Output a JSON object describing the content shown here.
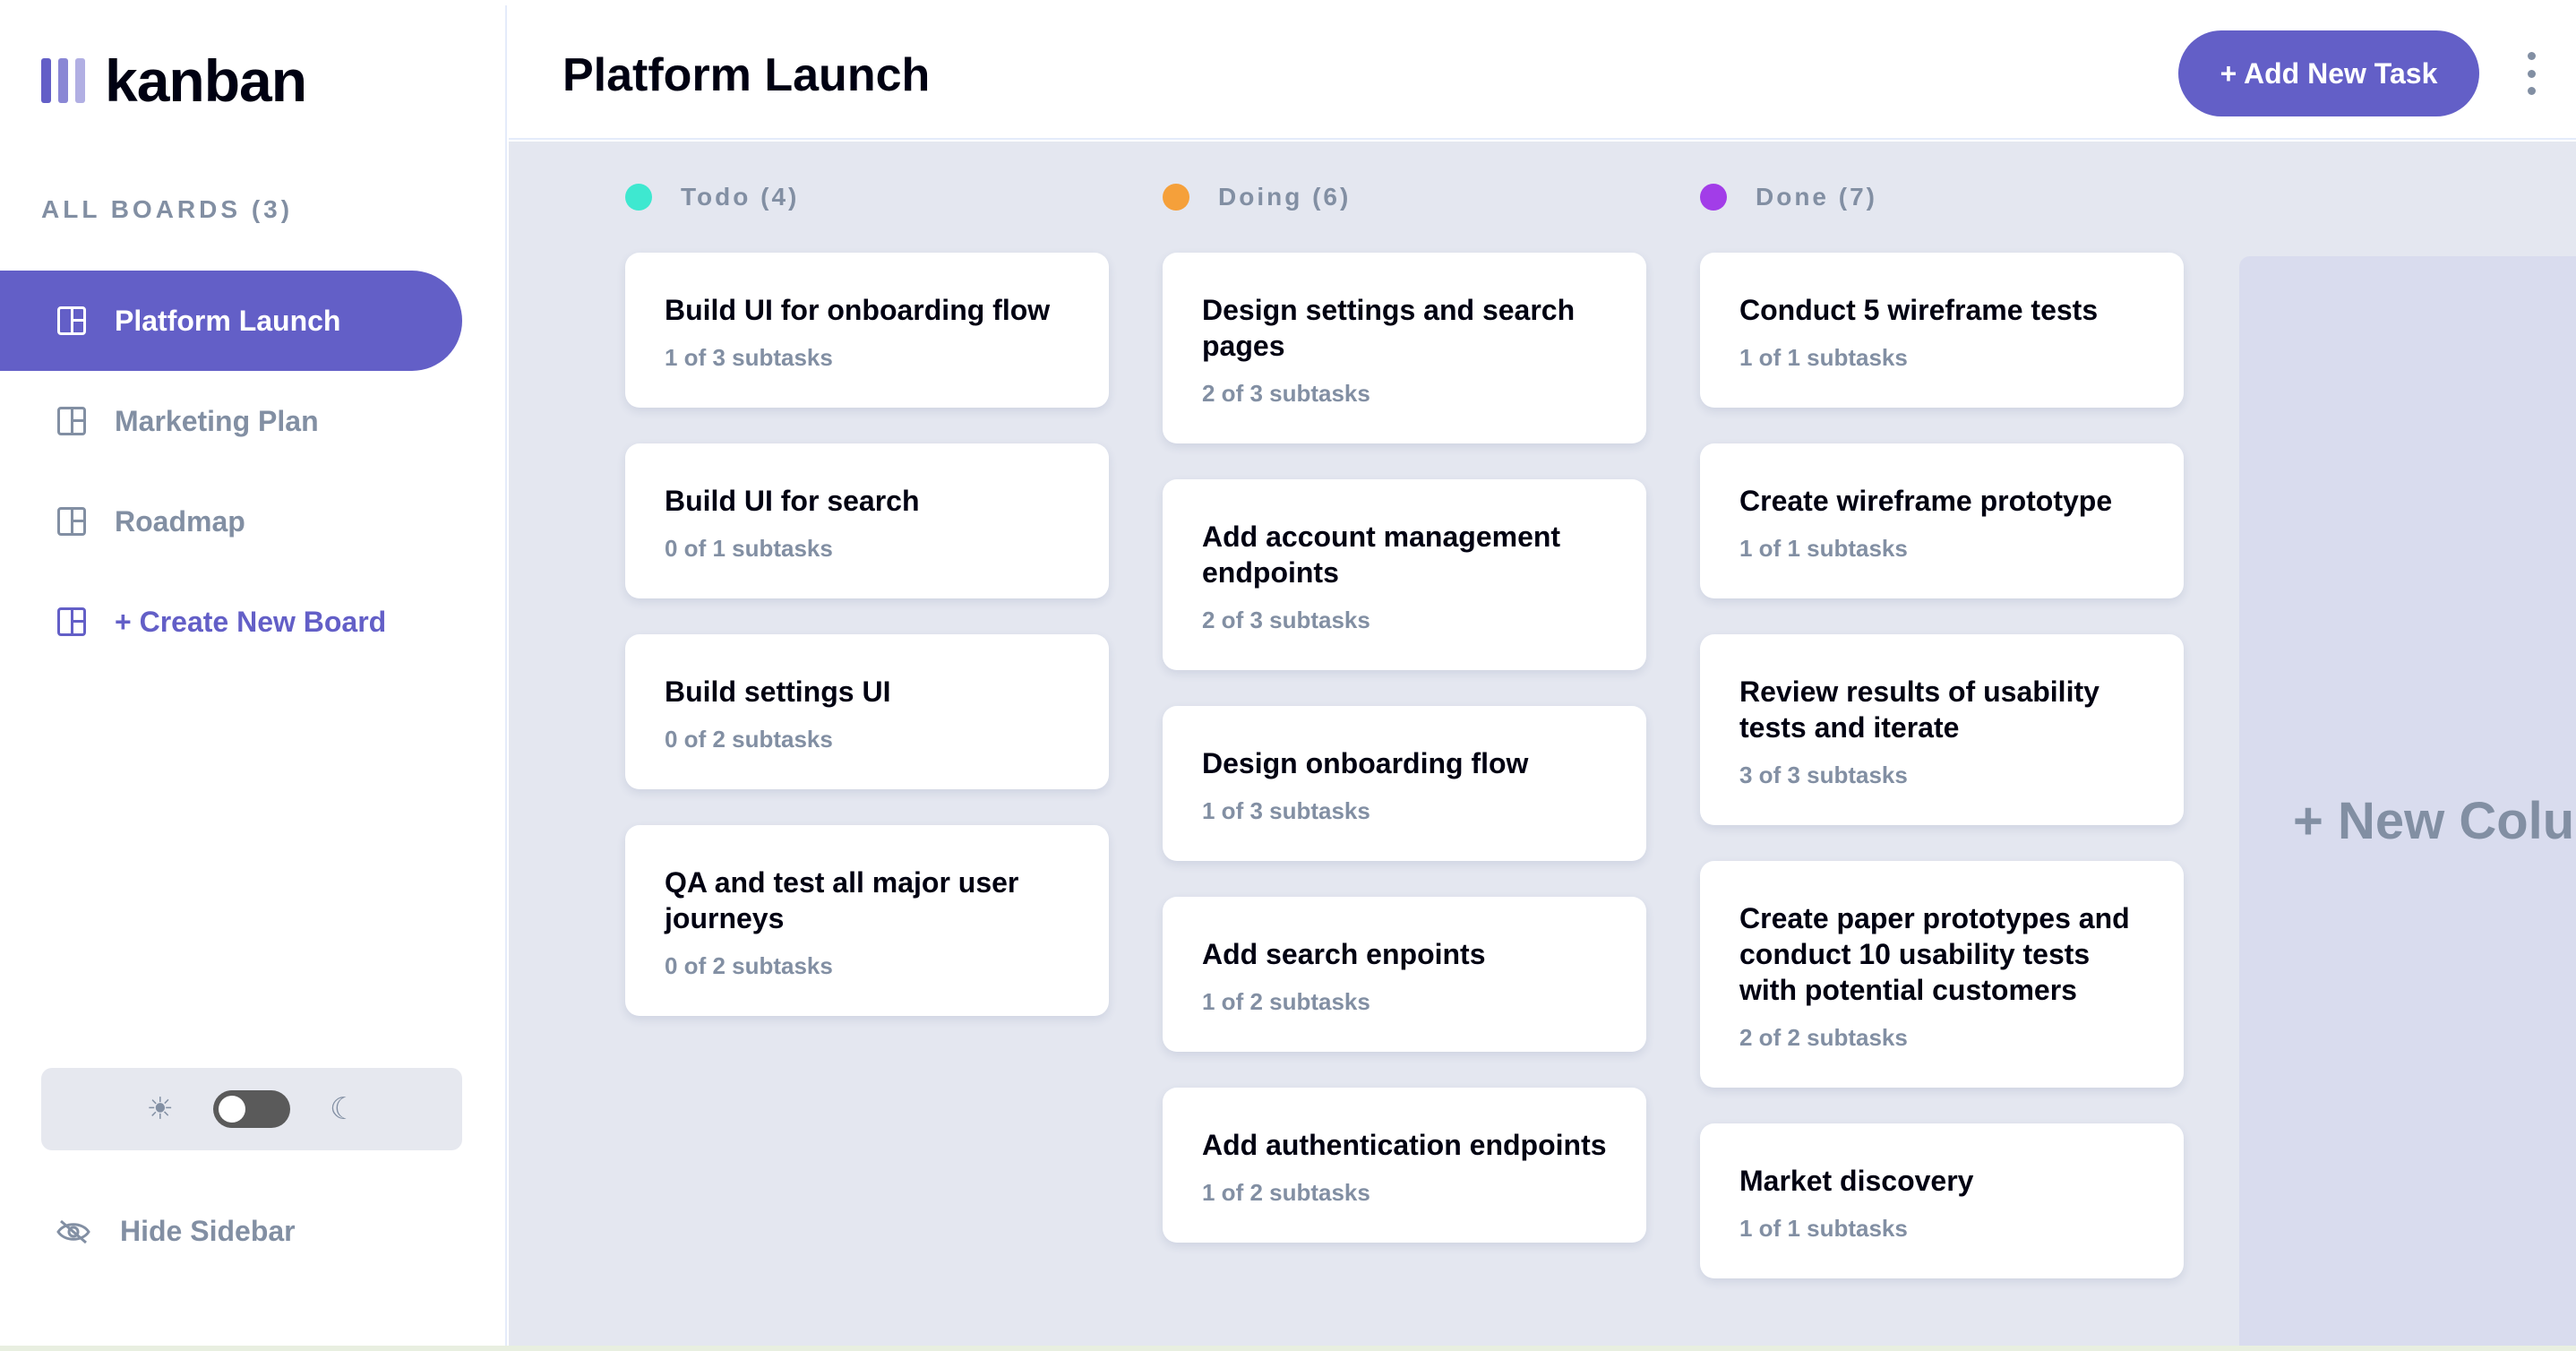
{
  "sidebar": {
    "logo_text": "kanban",
    "all_boards_label": "ALL BOARDS (3)",
    "boards": [
      {
        "label": "Platform Launch",
        "active": true
      },
      {
        "label": "Marketing Plan",
        "active": false
      },
      {
        "label": "Roadmap",
        "active": false
      }
    ],
    "create_board_label": "+ Create New Board",
    "theme": {
      "mode": "light",
      "dark_enabled": false
    },
    "hide_sidebar_label": "Hide Sidebar"
  },
  "header": {
    "board_title": "Platform Launch",
    "add_task_label": "+ Add New Task"
  },
  "columns": [
    {
      "title": "Todo (4)",
      "color": "#49C4E5",
      "tasks": [
        {
          "title": "Build UI for onboarding flow",
          "subtasks": "1 of 3 subtasks"
        },
        {
          "title": "Build UI for search",
          "subtasks": "0 of 1 subtasks"
        },
        {
          "title": "Build settings UI",
          "subtasks": "0 of 2 subtasks"
        },
        {
          "title": "QA and test all major user journeys",
          "subtasks": "0 of 2 subtasks"
        }
      ]
    },
    {
      "title": "Doing (6)",
      "color": "#F5A03A",
      "tasks": [
        {
          "title": "Design settings and search pages",
          "subtasks": "2 of 3 subtasks"
        },
        {
          "title": "Add account management endpoints",
          "subtasks": "2 of 3 subtasks"
        },
        {
          "title": "Design onboarding flow",
          "subtasks": "1 of 3 subtasks"
        },
        {
          "title": "Add search enpoints",
          "subtasks": "1 of 2 subtasks"
        },
        {
          "title": "Add authentication endpoints",
          "subtasks": "1 of 2 subtasks"
        }
      ]
    },
    {
      "title": "Done (7)",
      "color": "#A23DE8",
      "tasks": [
        {
          "title": "Conduct 5 wireframe tests",
          "subtasks": "1 of 1 subtasks"
        },
        {
          "title": "Create wireframe prototype",
          "subtasks": "1 of 1 subtasks"
        },
        {
          "title": "Review results of usability tests and iterate",
          "subtasks": "3 of 3 subtasks"
        },
        {
          "title": "Create paper prototypes and conduct 10 usability tests with potential customers",
          "subtasks": "2 of 2 subtasks"
        },
        {
          "title": "Market discovery",
          "subtasks": "1 of 1 subtasks"
        }
      ]
    }
  ],
  "new_column_label": "+ New Column",
  "colors": {
    "accent": "#635FC7",
    "muted": "#828FA3",
    "board_bg": "#E4E7F0"
  }
}
